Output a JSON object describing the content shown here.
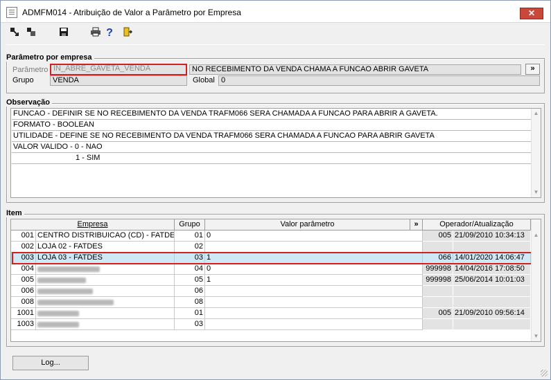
{
  "window": {
    "title": "ADMFM014 - Atribuição de Valor a Parâmetro por Empresa",
    "close_glyph": "✕"
  },
  "toolbar": {
    "icons": [
      "move-icon",
      "duplicate-icon",
      "save-icon",
      "print-icon",
      "help-icon",
      "exit-icon"
    ],
    "help_glyph": "?"
  },
  "parametro": {
    "section_title": "Parâmetro por empresa",
    "parametro_label": "Parâmetro",
    "parametro_value": "IN_ABRE_GAVETA_VENDA",
    "parametro_desc": "NO RECEBIMENTO DA VENDA CHAMA A FUNCAO ABRIR GAVETA",
    "expand_label": "»",
    "grupo_label": "Grupo",
    "grupo_value": "VENDA",
    "global_label": "Global",
    "global_value": "0"
  },
  "observacao": {
    "section_title": "Observação",
    "lines": [
      "FUNCAO - DEFINIR SE NO RECEBIMENTO DA VENDA TRAFM066 SERA CHAMADA A FUNCAO PARA ABRIR A GAVETA.",
      "FORMATO - BOOLEAN",
      "UTILIDADE - DEFINE SE NO RECEBIMENTO DA VENDA TRAFM066 SERA CHAMADA A FUNCAO PARA ABRIR GAVETA",
      "VALOR VALIDO - 0 - NAO",
      "1 - SIM"
    ]
  },
  "item": {
    "section_title": "Item",
    "headers": {
      "empresa": "Empresa",
      "grupo": "Grupo",
      "valor": "Valor parâmetro",
      "expand": "»",
      "operador": "Operador/Atualização"
    },
    "rows": [
      {
        "code": "001",
        "empresa": "CENTRO DISTRIBUICAO (CD) - FATDES",
        "grupo": "01",
        "valor": "0",
        "operador": "005",
        "data": "21/09/2010 10:34:13"
      },
      {
        "code": "002",
        "empresa": "LOJA 02 - FATDES",
        "grupo": "02",
        "valor": "",
        "operador": "",
        "data": ""
      },
      {
        "code": "003",
        "empresa": "LOJA 03 - FATDES",
        "grupo": "03",
        "valor": "1",
        "operador": "066",
        "data": "14/01/2020 14:06:47"
      },
      {
        "code": "004",
        "empresa": "",
        "grupo": "04",
        "valor": "0",
        "operador": "999998",
        "data": "14/04/2016 17:08:50"
      },
      {
        "code": "005",
        "empresa": "",
        "grupo": "05",
        "valor": "1",
        "operador": "999998",
        "data": "25/06/2014 10:01:03"
      },
      {
        "code": "006",
        "empresa": "",
        "grupo": "06",
        "valor": "",
        "operador": "",
        "data": ""
      },
      {
        "code": "008",
        "empresa": "",
        "grupo": "08",
        "valor": "",
        "operador": "",
        "data": ""
      },
      {
        "code": "1001",
        "empresa": "",
        "grupo": "01",
        "valor": "",
        "operador": "005",
        "data": "21/09/2010 09:56:14"
      },
      {
        "code": "1003",
        "empresa": "",
        "grupo": "03",
        "valor": "",
        "operador": "",
        "data": ""
      }
    ]
  },
  "footer": {
    "log_button": "Log..."
  }
}
